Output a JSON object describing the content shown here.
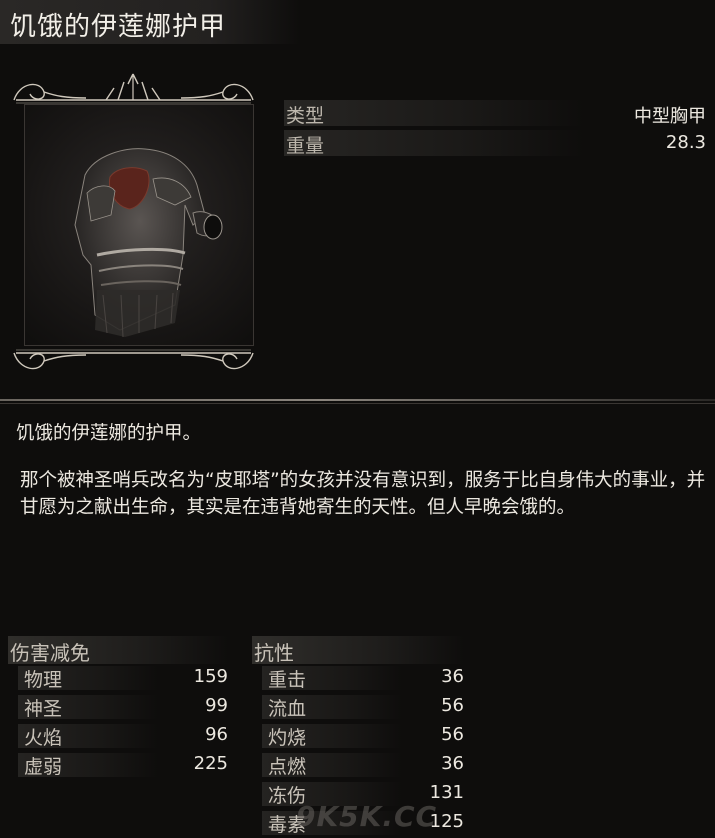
{
  "item": {
    "name": "饥饿的伊莲娜护甲",
    "type_label": "类型",
    "type_value": "中型胸甲",
    "weight_label": "重量",
    "weight_value": "28.3"
  },
  "description": {
    "line1": "饥饿的伊莲娜的护甲。",
    "line2": "那个被神圣哨兵改名为“皮耶塔”的女孩并没有意识到，服务于比自身伟大的事业，并甘愿为之献出生命，其实是在违背她寄生的天性。但人早晚会饿的。"
  },
  "damage_negation": {
    "header": "伤害减免",
    "rows": [
      {
        "label": "物理",
        "value": "159"
      },
      {
        "label": "神圣",
        "value": "99"
      },
      {
        "label": "火焰",
        "value": "96"
      },
      {
        "label": "虚弱",
        "value": "225"
      }
    ]
  },
  "resistance": {
    "header": "抗性",
    "rows": [
      {
        "label": "重击",
        "value": "36"
      },
      {
        "label": "流血",
        "value": "56"
      },
      {
        "label": "灼烧",
        "value": "56"
      },
      {
        "label": "点燃",
        "value": "36"
      },
      {
        "label": "冻伤",
        "value": "131"
      },
      {
        "label": "毒素",
        "value": "125"
      }
    ]
  },
  "watermark": "9K5K.CC",
  "icons": {
    "armor": "chest-armor-icon",
    "frame_top": "ornament-top-icon",
    "frame_bottom": "ornament-bottom-icon"
  }
}
